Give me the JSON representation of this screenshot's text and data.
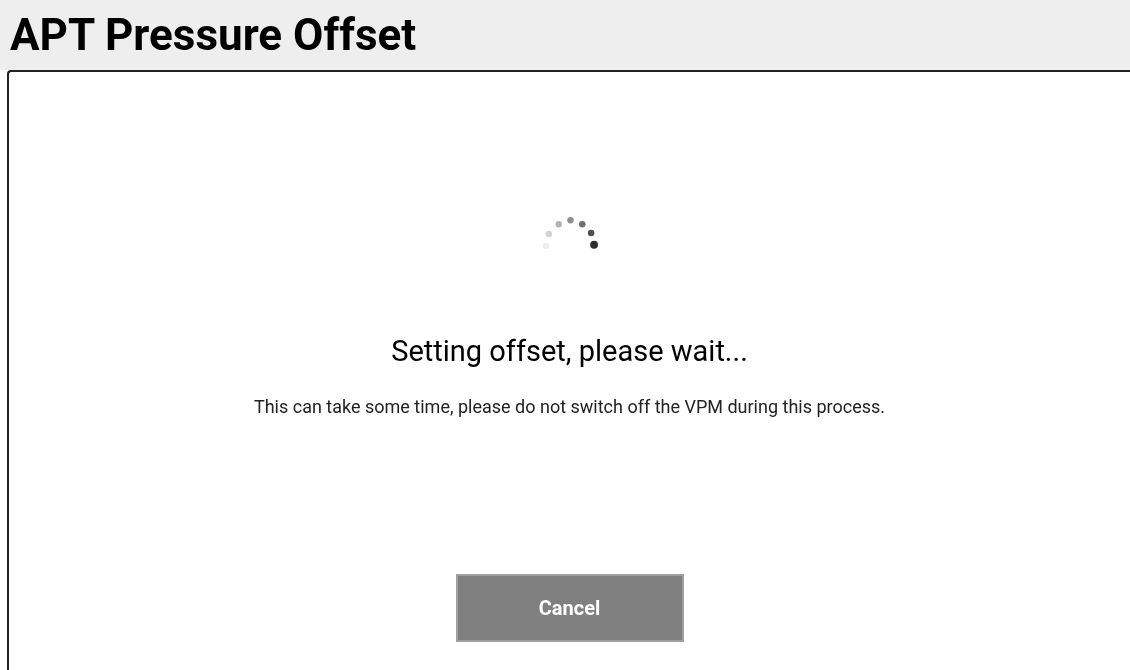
{
  "header": {
    "title": "APT Pressure Offset"
  },
  "dialog": {
    "heading": "Setting offset, please wait...",
    "message": "This can take some time, please do not switch off the VPM during this process.",
    "buttons": [
      {
        "label": "Cancel"
      }
    ]
  }
}
